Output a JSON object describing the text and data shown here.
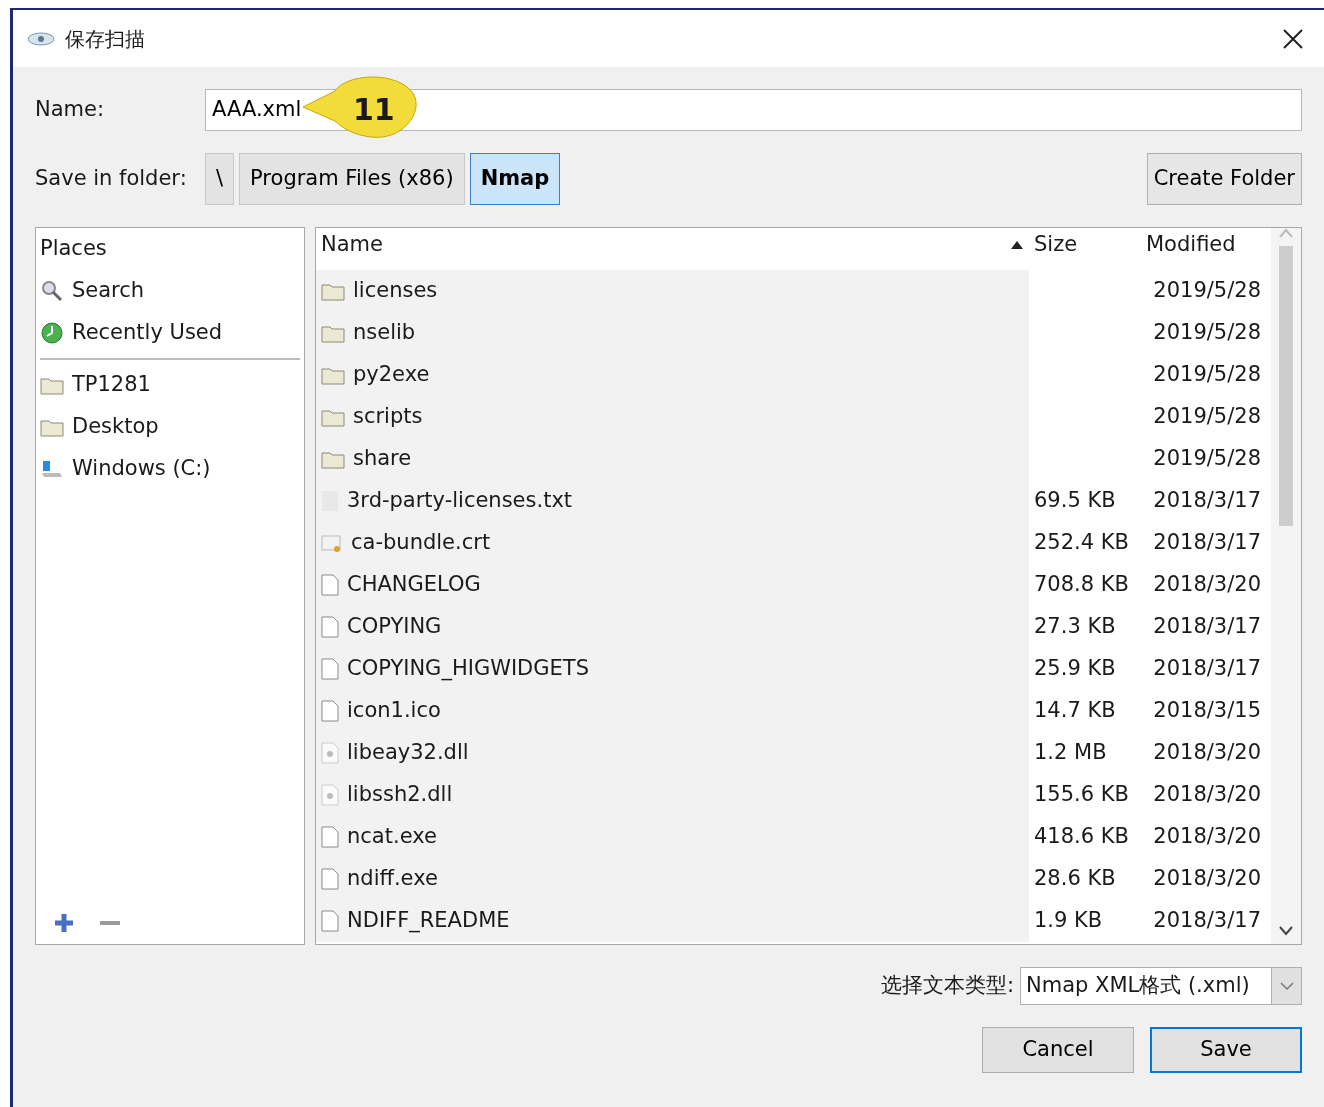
{
  "window": {
    "title": "保存扫描"
  },
  "name_field": {
    "label": "Name:",
    "value": "AAA.xml"
  },
  "callout": {
    "text": "11"
  },
  "save_in_folder": {
    "label": "Save in folder:",
    "crumbs": [
      {
        "label": "\\",
        "selected": false
      },
      {
        "label": "Program Files (x86)",
        "selected": false
      },
      {
        "label": "Nmap",
        "selected": true
      }
    ],
    "create_folder": "Create Folder"
  },
  "places": {
    "heading": "Places",
    "items": [
      {
        "kind": "search",
        "label": "Search"
      },
      {
        "kind": "recent",
        "label": "Recently Used"
      },
      {
        "kind": "separator"
      },
      {
        "kind": "folder",
        "label": "TP1281"
      },
      {
        "kind": "folder",
        "label": "Desktop"
      },
      {
        "kind": "drive",
        "label": "Windows (C:)"
      }
    ]
  },
  "file_list": {
    "columns": [
      {
        "label": "Name",
        "sorted": true
      },
      {
        "label": "Size",
        "sorted": false
      },
      {
        "label": "Modified",
        "sorted": false
      }
    ],
    "rows": [
      {
        "kind": "folder",
        "name": "licenses",
        "modified": "2019/5/28"
      },
      {
        "kind": "folder",
        "name": "nselib",
        "modified": "2019/5/28"
      },
      {
        "kind": "folder",
        "name": "py2exe",
        "modified": "2019/5/28"
      },
      {
        "kind": "folder",
        "name": "scripts",
        "modified": "2019/5/28"
      },
      {
        "kind": "folder",
        "name": "share",
        "modified": "2019/5/28"
      },
      {
        "kind": "text",
        "name": "3rd-party-licenses.txt",
        "size": "69.5 KB",
        "modified": "2018/3/17"
      },
      {
        "kind": "cert",
        "name": "ca-bundle.crt",
        "size": "252.4 KB",
        "modified": "2018/3/17"
      },
      {
        "kind": "file",
        "name": "CHANGELOG",
        "size": "708.8 KB",
        "modified": "2018/3/20"
      },
      {
        "kind": "file",
        "name": "COPYING",
        "size": "27.3 KB",
        "modified": "2018/3/17"
      },
      {
        "kind": "file",
        "name": "COPYING_HIGWIDGETS",
        "size": "25.9 KB",
        "modified": "2018/3/17"
      },
      {
        "kind": "file",
        "name": "icon1.ico",
        "size": "14.7 KB",
        "modified": "2018/3/15"
      },
      {
        "kind": "dll",
        "name": "libeay32.dll",
        "size": "1.2 MB",
        "modified": "2018/3/20"
      },
      {
        "kind": "dll",
        "name": "libssh2.dll",
        "size": "155.6 KB",
        "modified": "2018/3/20"
      },
      {
        "kind": "file",
        "name": "ncat.exe",
        "size": "418.6 KB",
        "modified": "2018/3/20"
      },
      {
        "kind": "file",
        "name": "ndiff.exe",
        "size": "28.6 KB",
        "modified": "2018/3/20"
      },
      {
        "kind": "file",
        "name": "NDIFF_README",
        "size": "1.9 KB",
        "modified": "2018/3/17"
      }
    ]
  },
  "file_type": {
    "label": "选择文本类型:",
    "value": "Nmap XML格式 (.xml)"
  },
  "buttons": [
    {
      "label": "Cancel",
      "default": false
    },
    {
      "label": "Save",
      "default": true
    }
  ]
}
